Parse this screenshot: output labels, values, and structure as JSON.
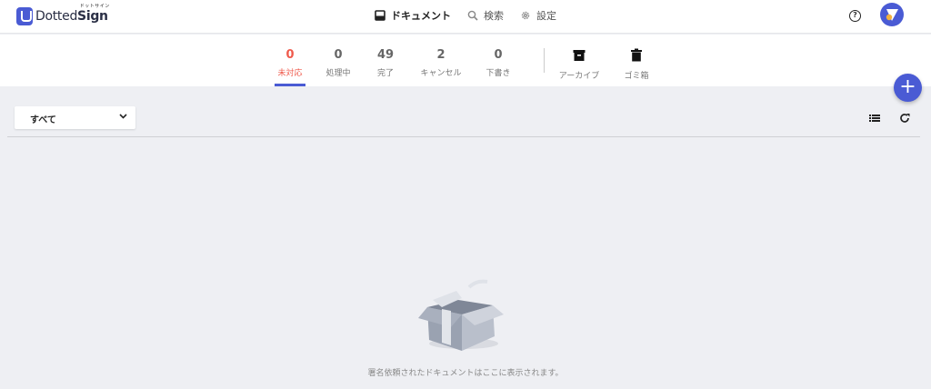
{
  "app": {
    "logo_text_main": "Dotted",
    "logo_text_bold": "Sign",
    "logo_kana": "ドットサイン"
  },
  "nav": {
    "documents": "ドキュメント",
    "search": "検索",
    "settings": "設定"
  },
  "header_icons": {
    "help": "?"
  },
  "tabs": [
    {
      "count": "0",
      "label": "未対応"
    },
    {
      "count": "0",
      "label": "処理中"
    },
    {
      "count": "49",
      "label": "完了"
    },
    {
      "count": "2",
      "label": "キャンセル"
    },
    {
      "count": "0",
      "label": "下書き"
    }
  ],
  "icon_tabs": [
    {
      "label": "アーカイブ",
      "icon": "archive-icon"
    },
    {
      "label": "ゴミ箱",
      "icon": "trash-icon"
    }
  ],
  "fab": {
    "label": "+"
  },
  "filter": {
    "value": "すべて"
  },
  "toolbar": {
    "list_icon": "list-view-icon",
    "refresh_icon": "refresh-icon"
  },
  "empty_state": {
    "message": "署名依頼されたドキュメントはここに表示されます。"
  },
  "colors": {
    "accent": "#4a5bd4",
    "active_tab": "#ef5a4c",
    "background": "#eeeff3"
  }
}
